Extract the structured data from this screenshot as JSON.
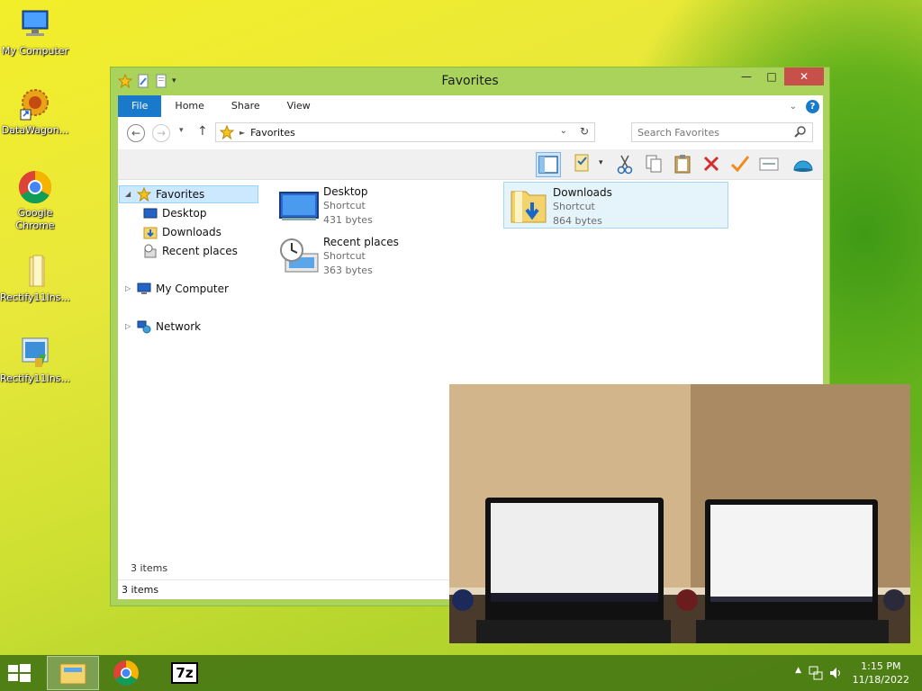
{
  "desktop": {
    "icons": [
      {
        "label": "My Computer",
        "icon": "computer-icon"
      },
      {
        "label": "DataWagon...",
        "icon": "datawagon-icon"
      },
      {
        "label": "Google Chrome",
        "icon": "chrome-icon"
      },
      {
        "label": "Rectify11Ins...",
        "icon": "folder-icon"
      },
      {
        "label": "Rectify11Ins...",
        "icon": "installer-icon"
      }
    ]
  },
  "window": {
    "title": "Favorites",
    "ribbon_tabs": [
      "File",
      "Home",
      "Share",
      "View"
    ],
    "address": "Favorites",
    "search_placeholder": "Search Favorites",
    "nav": {
      "favorites": "Favorites",
      "desktop": "Desktop",
      "downloads": "Downloads",
      "recent": "Recent places",
      "my_computer": "My Computer",
      "network": "Network"
    },
    "files": [
      {
        "name": "Desktop",
        "type": "Shortcut",
        "size": "431 bytes"
      },
      {
        "name": "Recent places",
        "type": "Shortcut",
        "size": "363 bytes"
      },
      {
        "name": "Downloads",
        "type": "Shortcut",
        "size": "864 bytes"
      }
    ],
    "item_count": "3 items",
    "status_text": "3 items"
  },
  "taskbar": {
    "time": "1:15 PM",
    "date": "11/18/2022",
    "apps": [
      "file-explorer-icon",
      "chrome-icon",
      "7zip-icon"
    ],
    "sevenzip_label": "7z"
  },
  "colors": {
    "accent": "#1979ca",
    "window_frame": "#a9d35a",
    "close_button": "#c7504a",
    "selection": "#cce8ff"
  }
}
